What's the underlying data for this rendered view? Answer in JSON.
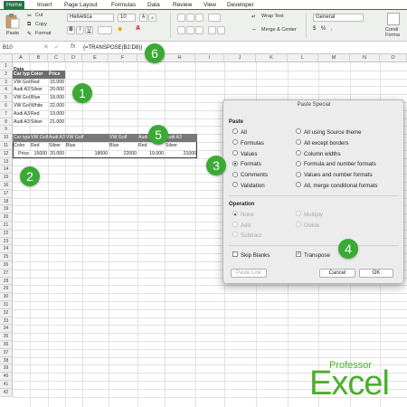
{
  "tabs": [
    "Home",
    "Insert",
    "Page Layout",
    "Formulas",
    "Data",
    "Review",
    "View",
    "Developer"
  ],
  "ribbon": {
    "cut": "Cut",
    "copy": "Copy",
    "format": "Format",
    "paste": "Paste",
    "font_name": "Helvetica",
    "font_size": "10",
    "wrap_text": "Wrap Text",
    "merge_center": "Merge & Center",
    "number_format": "General",
    "conditional": "Condi",
    "formatting": "Forma"
  },
  "formula_bar": {
    "name_box": "B10",
    "fx": "fx",
    "formula": "{=TRANSPOSE(B2:D8)}"
  },
  "columns": [
    "A",
    "B",
    "C",
    "D",
    "E",
    "F",
    "G",
    "H",
    "I",
    "J",
    "K",
    "L",
    "M",
    "N",
    "O"
  ],
  "rows": [
    "1",
    "2",
    "3",
    "4",
    "5",
    "6",
    "7",
    "8",
    "9",
    "10",
    "11",
    "12",
    "13",
    "14",
    "15",
    "16",
    "17",
    "18",
    "19",
    "20",
    "21",
    "22",
    "23",
    "24",
    "25",
    "26",
    "27",
    "28",
    "29",
    "30",
    "31",
    "32",
    "33",
    "34",
    "35",
    "36",
    "37",
    "38",
    "39",
    "40",
    "41",
    "42"
  ],
  "source_table": {
    "title": "Data",
    "headers": [
      "Car type",
      "Color",
      "Price"
    ],
    "rows": [
      [
        "VW Golf",
        "Red",
        "15.000"
      ],
      [
        "Audi A3",
        "Silver",
        "20.000"
      ],
      [
        "VW Golf",
        "Blue",
        "18.000"
      ],
      [
        "VW Golf",
        "White",
        "22.000"
      ],
      [
        "Audi A3",
        "Red",
        "19.000"
      ],
      [
        "Audi A3",
        "Silver",
        "21.000"
      ]
    ]
  },
  "transposed": {
    "row1": [
      "Car type",
      "VW Golf",
      "Audi A3",
      "VW Golf",
      "VW Golf",
      "Audi A3",
      "Audi A3"
    ],
    "row2": [
      "Color",
      "Red",
      "Silver",
      "Blue",
      "Blue",
      "Red",
      "Silver"
    ],
    "row3": [
      "Price",
      "15000",
      "20.000",
      "18000",
      "22000",
      "19.000",
      "21000"
    ]
  },
  "dialog": {
    "title": "Paste Special",
    "paste_label": "Paste",
    "paste_left": [
      "All",
      "Formulas",
      "Values",
      "Formats",
      "Comments",
      "Validation"
    ],
    "paste_right": [
      "All using Source theme",
      "All except borders",
      "Column widths",
      "Formula and number formats",
      "Values and number formats",
      "All, merge conditional formats"
    ],
    "operation_label": "Operation",
    "operation_left": [
      "None",
      "Add",
      "Subtract"
    ],
    "operation_right": [
      "Multiply",
      "Divide"
    ],
    "skip_blanks": "Skip Blanks",
    "transpose": "Transpose",
    "paste_link": "Paste Link",
    "cancel": "Cancel",
    "ok": "OK"
  },
  "callouts": [
    "1",
    "2",
    "3",
    "4",
    "5",
    "6"
  ],
  "logo": {
    "top": "Professor",
    "main": "Excel"
  },
  "colors": {
    "excel_green": "#217346",
    "callout_green": "#3aaa35",
    "logo_green": "#4caf2a"
  }
}
